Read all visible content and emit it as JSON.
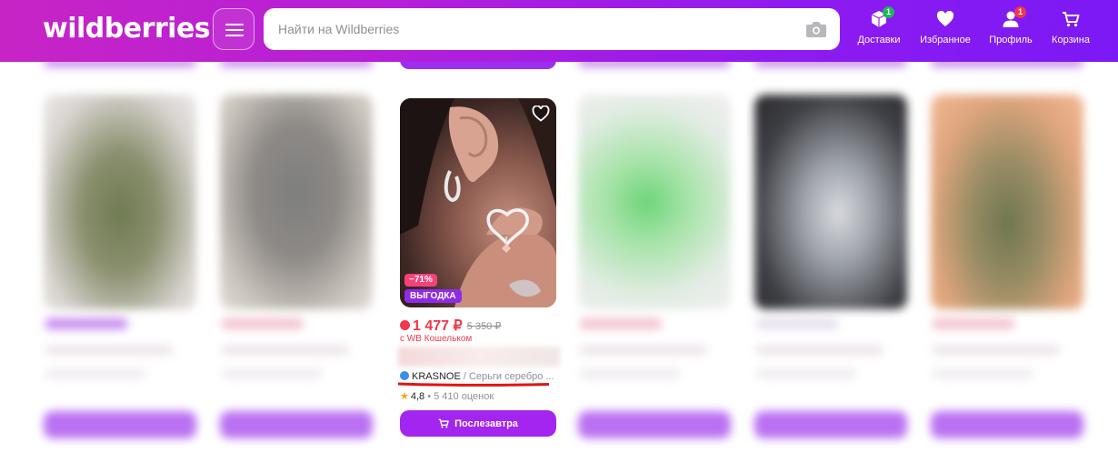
{
  "header": {
    "logo": "wildberries",
    "search_placeholder": "Найти на Wildberries",
    "nav": [
      {
        "label": "Доставки",
        "badge": "1",
        "badge_color": "#1fb65a"
      },
      {
        "label": "Избранное"
      },
      {
        "label": "Профиль",
        "badge": "1",
        "badge_color": "#f0374c"
      },
      {
        "label": "Корзина"
      }
    ]
  },
  "product": {
    "discount": "−71%",
    "tag": "ВЫГОДКА",
    "price": "1 477 ₽",
    "old_price": "5 350 ₽",
    "wallet_note": "с WB Кошельком",
    "brand": "KRASNOE",
    "name": " / Серьги серебро ...",
    "rating": "4,8",
    "reviews": " • 5 410 оценок",
    "button_label": "Послезавтра"
  },
  "colors": {
    "accent": "#a325ef",
    "price": "#f0374c",
    "header_left": "#c724c5",
    "header_right": "#7b19f5"
  }
}
